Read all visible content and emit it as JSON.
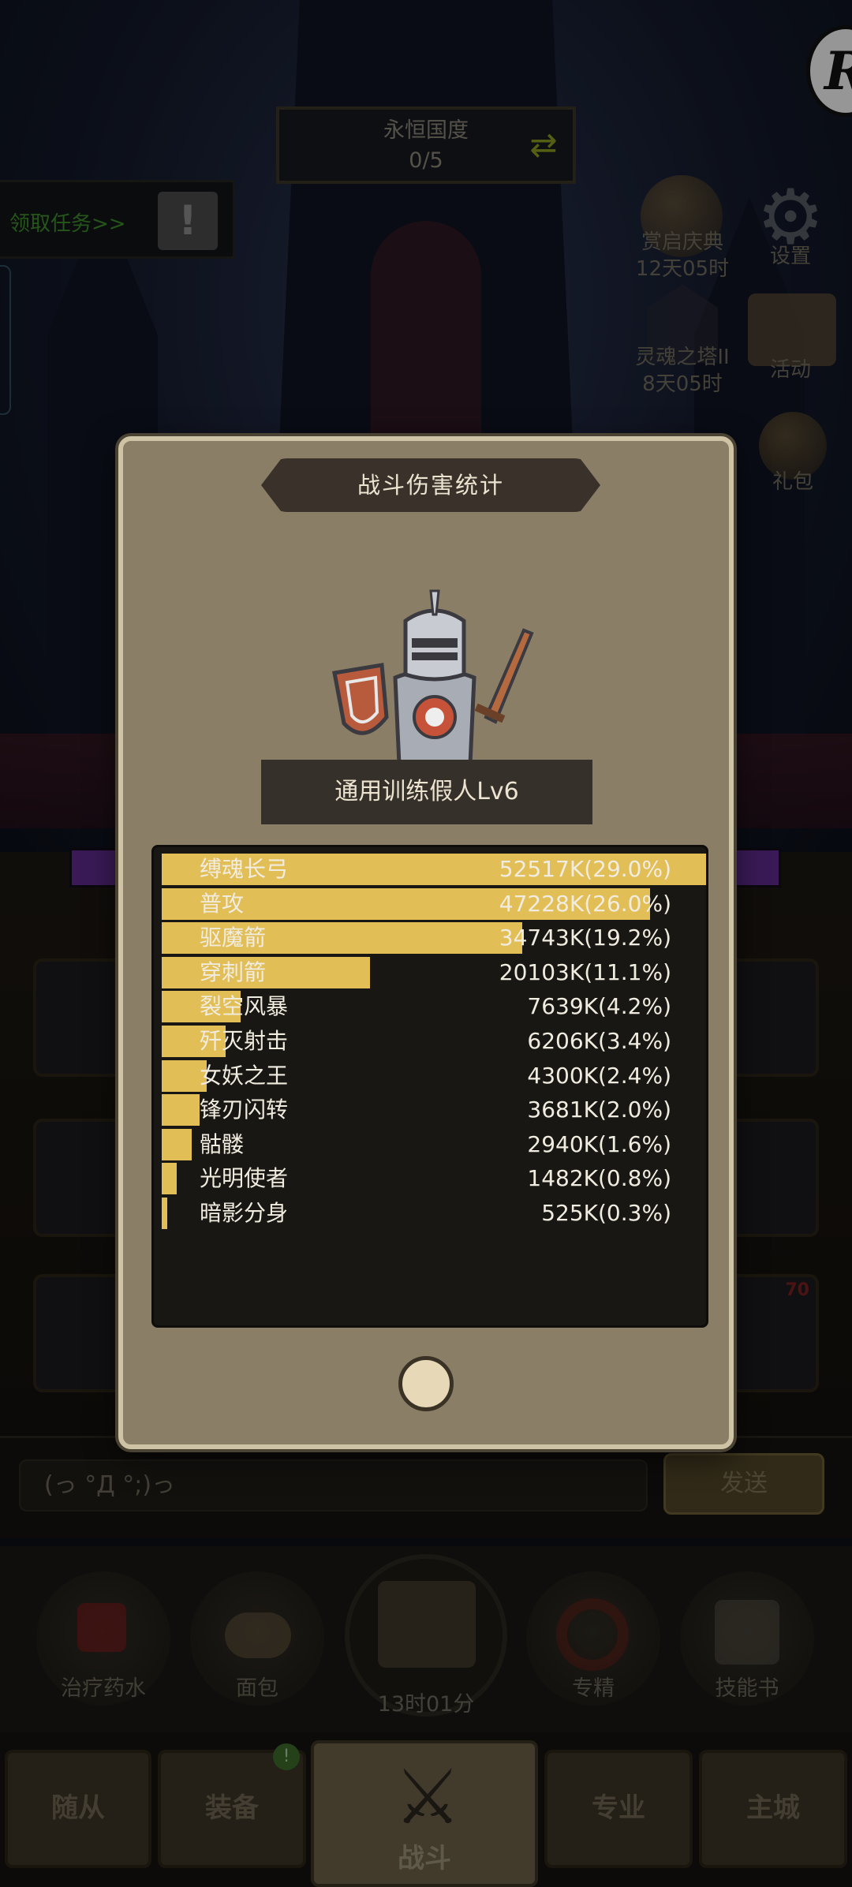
{
  "header": {
    "realm_title": "永恒国度",
    "realm_progress": "0/5",
    "quest_link": "领取任务>>"
  },
  "side_menu": [
    {
      "label": "赏启庆典",
      "timer": "12天05时",
      "icon": "mooncake-icon"
    },
    {
      "label": "设置",
      "icon": "gear-icon"
    },
    {
      "label": "灵魂之塔II",
      "timer": "8天05时",
      "icon": "tower-icon"
    },
    {
      "label": "活动",
      "icon": "scroll-icon"
    },
    {
      "label": "礼包",
      "icon": "helmet-icon"
    }
  ],
  "modal": {
    "title": "战斗伤害统计",
    "target": "通用训练假人Lv6",
    "rows": [
      {
        "name": "缚魂长弓",
        "value": "52517K(29.0%)",
        "percent": 29.0
      },
      {
        "name": "普攻",
        "value": "47228K(26.0%)",
        "percent": 26.0
      },
      {
        "name": "驱魔箭",
        "value": "34743K(19.2%)",
        "percent": 19.2
      },
      {
        "name": "穿刺箭",
        "value": "20103K(11.1%)",
        "percent": 11.1
      },
      {
        "name": "裂空风暴",
        "value": "7639K(4.2%)",
        "percent": 4.2
      },
      {
        "name": "歼灭射击",
        "value": "6206K(3.4%)",
        "percent": 3.4
      },
      {
        "name": "女妖之王",
        "value": "4300K(2.4%)",
        "percent": 2.4
      },
      {
        "name": "锋刃闪转",
        "value": "3681K(2.0%)",
        "percent": 2.0
      },
      {
        "name": "骷髅",
        "value": "2940K(1.6%)",
        "percent": 1.6
      },
      {
        "name": "光明使者",
        "value": "1482K(0.8%)",
        "percent": 0.8
      },
      {
        "name": "暗影分身",
        "value": "525K(0.3%)",
        "percent": 0.3
      }
    ]
  },
  "chat": {
    "input_value": "(っ °Д °;)っ",
    "send_label": "发送"
  },
  "items": [
    {
      "label": "治疗药水",
      "icon": "potion-icon"
    },
    {
      "label": "面包",
      "icon": "bread-icon"
    },
    {
      "label": "专精",
      "icon": "specialize-icon"
    },
    {
      "label": "技能书",
      "icon": "skillbook-icon"
    }
  ],
  "chest_timer": "13时01分",
  "slot_level": "70",
  "nav": {
    "tabs": [
      "随从",
      "装备",
      "战斗",
      "专业",
      "主城"
    ],
    "badge": "!"
  },
  "colors": {
    "bar_fill": "#e2be57",
    "panel_bg": "#191714",
    "modal_bg": "#8a7e66"
  }
}
